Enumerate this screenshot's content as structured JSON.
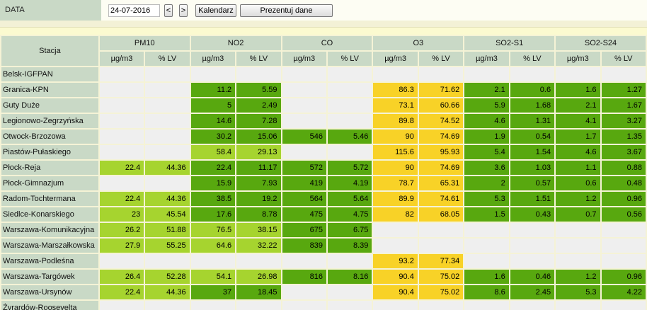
{
  "toolbar": {
    "label": "DATA",
    "date_value": "24-07-2016",
    "prev_label": "<",
    "next_label": ">",
    "calendar_label": "Kalendarz",
    "present_label": "Prezentuj dane"
  },
  "table": {
    "station_header": "Stacja",
    "groups": [
      "PM10",
      "NO2",
      "CO",
      "O3",
      "SO2-S1",
      "SO2-S24"
    ],
    "subheaders": [
      "µg/m3",
      "% LV"
    ],
    "level_colors": {
      "empty": "#efefef",
      "very_good": "#58a80f",
      "good": "#a6d42f",
      "moderate": "#f8d227"
    },
    "rows": [
      {
        "station": "Belsk-IGFPAN",
        "cells": [
          {
            "v": "",
            "l": "empty"
          },
          {
            "v": "",
            "l": "empty"
          },
          {
            "v": "",
            "l": "empty"
          },
          {
            "v": "",
            "l": "empty"
          },
          {
            "v": "",
            "l": "empty"
          },
          {
            "v": "",
            "l": "empty"
          },
          {
            "v": "",
            "l": "empty"
          },
          {
            "v": "",
            "l": "empty"
          },
          {
            "v": "",
            "l": "empty"
          },
          {
            "v": "",
            "l": "empty"
          },
          {
            "v": "",
            "l": "empty"
          },
          {
            "v": "",
            "l": "empty"
          }
        ]
      },
      {
        "station": "Granica-KPN",
        "cells": [
          {
            "v": "",
            "l": "empty"
          },
          {
            "v": "",
            "l": "empty"
          },
          {
            "v": "11.2",
            "l": "dark"
          },
          {
            "v": "5.59",
            "l": "dark"
          },
          {
            "v": "",
            "l": "empty"
          },
          {
            "v": "",
            "l": "empty"
          },
          {
            "v": "86.3",
            "l": "yellow"
          },
          {
            "v": "71.62",
            "l": "yellow"
          },
          {
            "v": "2.1",
            "l": "dark"
          },
          {
            "v": "0.6",
            "l": "dark"
          },
          {
            "v": "1.6",
            "l": "dark"
          },
          {
            "v": "1.27",
            "l": "dark"
          }
        ]
      },
      {
        "station": "Guty Duże",
        "cells": [
          {
            "v": "",
            "l": "empty"
          },
          {
            "v": "",
            "l": "empty"
          },
          {
            "v": "5",
            "l": "dark"
          },
          {
            "v": "2.49",
            "l": "dark"
          },
          {
            "v": "",
            "l": "empty"
          },
          {
            "v": "",
            "l": "empty"
          },
          {
            "v": "73.1",
            "l": "yellow"
          },
          {
            "v": "60.66",
            "l": "yellow"
          },
          {
            "v": "5.9",
            "l": "dark"
          },
          {
            "v": "1.68",
            "l": "dark"
          },
          {
            "v": "2.1",
            "l": "dark"
          },
          {
            "v": "1.67",
            "l": "dark"
          }
        ]
      },
      {
        "station": "Legionowo-Zegrzyńska",
        "cells": [
          {
            "v": "",
            "l": "empty"
          },
          {
            "v": "",
            "l": "empty"
          },
          {
            "v": "14.6",
            "l": "dark"
          },
          {
            "v": "7.28",
            "l": "dark"
          },
          {
            "v": "",
            "l": "empty"
          },
          {
            "v": "",
            "l": "empty"
          },
          {
            "v": "89.8",
            "l": "yellow"
          },
          {
            "v": "74.52",
            "l": "yellow"
          },
          {
            "v": "4.6",
            "l": "dark"
          },
          {
            "v": "1.31",
            "l": "dark"
          },
          {
            "v": "4.1",
            "l": "dark"
          },
          {
            "v": "3.27",
            "l": "dark"
          }
        ]
      },
      {
        "station": "Otwock-Brzozowa",
        "cells": [
          {
            "v": "",
            "l": "empty"
          },
          {
            "v": "",
            "l": "empty"
          },
          {
            "v": "30.2",
            "l": "dark"
          },
          {
            "v": "15.06",
            "l": "dark"
          },
          {
            "v": "546",
            "l": "dark"
          },
          {
            "v": "5.46",
            "l": "dark"
          },
          {
            "v": "90",
            "l": "yellow"
          },
          {
            "v": "74.69",
            "l": "yellow"
          },
          {
            "v": "1.9",
            "l": "dark"
          },
          {
            "v": "0.54",
            "l": "dark"
          },
          {
            "v": "1.7",
            "l": "dark"
          },
          {
            "v": "1.35",
            "l": "dark"
          }
        ]
      },
      {
        "station": "Piastów-Pułaskiego",
        "cells": [
          {
            "v": "",
            "l": "empty"
          },
          {
            "v": "",
            "l": "empty"
          },
          {
            "v": "58.4",
            "l": "light"
          },
          {
            "v": "29.13",
            "l": "light"
          },
          {
            "v": "",
            "l": "empty"
          },
          {
            "v": "",
            "l": "empty"
          },
          {
            "v": "115.6",
            "l": "yellow"
          },
          {
            "v": "95.93",
            "l": "yellow"
          },
          {
            "v": "5.4",
            "l": "dark"
          },
          {
            "v": "1.54",
            "l": "dark"
          },
          {
            "v": "4.6",
            "l": "dark"
          },
          {
            "v": "3.67",
            "l": "dark"
          }
        ]
      },
      {
        "station": "Płock-Reja",
        "cells": [
          {
            "v": "22.4",
            "l": "light"
          },
          {
            "v": "44.36",
            "l": "light"
          },
          {
            "v": "22.4",
            "l": "dark"
          },
          {
            "v": "11.17",
            "l": "dark"
          },
          {
            "v": "572",
            "l": "dark"
          },
          {
            "v": "5.72",
            "l": "dark"
          },
          {
            "v": "90",
            "l": "yellow"
          },
          {
            "v": "74.69",
            "l": "yellow"
          },
          {
            "v": "3.6",
            "l": "dark"
          },
          {
            "v": "1.03",
            "l": "dark"
          },
          {
            "v": "1.1",
            "l": "dark"
          },
          {
            "v": "0.88",
            "l": "dark"
          }
        ]
      },
      {
        "station": "Płock-Gimnazjum",
        "cells": [
          {
            "v": "",
            "l": "empty"
          },
          {
            "v": "",
            "l": "empty"
          },
          {
            "v": "15.9",
            "l": "dark"
          },
          {
            "v": "7.93",
            "l": "dark"
          },
          {
            "v": "419",
            "l": "dark"
          },
          {
            "v": "4.19",
            "l": "dark"
          },
          {
            "v": "78.7",
            "l": "yellow"
          },
          {
            "v": "65.31",
            "l": "yellow"
          },
          {
            "v": "2",
            "l": "dark"
          },
          {
            "v": "0.57",
            "l": "dark"
          },
          {
            "v": "0.6",
            "l": "dark"
          },
          {
            "v": "0.48",
            "l": "dark"
          }
        ]
      },
      {
        "station": "Radom-Tochtermana",
        "cells": [
          {
            "v": "22.4",
            "l": "light"
          },
          {
            "v": "44.36",
            "l": "light"
          },
          {
            "v": "38.5",
            "l": "dark"
          },
          {
            "v": "19.2",
            "l": "dark"
          },
          {
            "v": "564",
            "l": "dark"
          },
          {
            "v": "5.64",
            "l": "dark"
          },
          {
            "v": "89.9",
            "l": "yellow"
          },
          {
            "v": "74.61",
            "l": "yellow"
          },
          {
            "v": "5.3",
            "l": "dark"
          },
          {
            "v": "1.51",
            "l": "dark"
          },
          {
            "v": "1.2",
            "l": "dark"
          },
          {
            "v": "0.96",
            "l": "dark"
          }
        ]
      },
      {
        "station": "Siedlce-Konarskiego",
        "cells": [
          {
            "v": "23",
            "l": "light"
          },
          {
            "v": "45.54",
            "l": "light"
          },
          {
            "v": "17.6",
            "l": "dark"
          },
          {
            "v": "8.78",
            "l": "dark"
          },
          {
            "v": "475",
            "l": "dark"
          },
          {
            "v": "4.75",
            "l": "dark"
          },
          {
            "v": "82",
            "l": "yellow"
          },
          {
            "v": "68.05",
            "l": "yellow"
          },
          {
            "v": "1.5",
            "l": "dark"
          },
          {
            "v": "0.43",
            "l": "dark"
          },
          {
            "v": "0.7",
            "l": "dark"
          },
          {
            "v": "0.56",
            "l": "dark"
          }
        ]
      },
      {
        "station": "Warszawa-Komunikacyjna",
        "cells": [
          {
            "v": "26.2",
            "l": "light"
          },
          {
            "v": "51.88",
            "l": "light"
          },
          {
            "v": "76.5",
            "l": "light"
          },
          {
            "v": "38.15",
            "l": "light"
          },
          {
            "v": "675",
            "l": "dark"
          },
          {
            "v": "6.75",
            "l": "dark"
          },
          {
            "v": "",
            "l": "empty"
          },
          {
            "v": "",
            "l": "empty"
          },
          {
            "v": "",
            "l": "empty"
          },
          {
            "v": "",
            "l": "empty"
          },
          {
            "v": "",
            "l": "empty"
          },
          {
            "v": "",
            "l": "empty"
          }
        ]
      },
      {
        "station": "Warszawa-Marszałkowska",
        "cells": [
          {
            "v": "27.9",
            "l": "light"
          },
          {
            "v": "55.25",
            "l": "light"
          },
          {
            "v": "64.6",
            "l": "light"
          },
          {
            "v": "32.22",
            "l": "light"
          },
          {
            "v": "839",
            "l": "dark"
          },
          {
            "v": "8.39",
            "l": "dark"
          },
          {
            "v": "",
            "l": "empty"
          },
          {
            "v": "",
            "l": "empty"
          },
          {
            "v": "",
            "l": "empty"
          },
          {
            "v": "",
            "l": "empty"
          },
          {
            "v": "",
            "l": "empty"
          },
          {
            "v": "",
            "l": "empty"
          }
        ]
      },
      {
        "station": "Warszawa-Podleśna",
        "cells": [
          {
            "v": "",
            "l": "empty"
          },
          {
            "v": "",
            "l": "empty"
          },
          {
            "v": "",
            "l": "empty"
          },
          {
            "v": "",
            "l": "empty"
          },
          {
            "v": "",
            "l": "empty"
          },
          {
            "v": "",
            "l": "empty"
          },
          {
            "v": "93.2",
            "l": "yellow"
          },
          {
            "v": "77.34",
            "l": "yellow"
          },
          {
            "v": "",
            "l": "empty"
          },
          {
            "v": "",
            "l": "empty"
          },
          {
            "v": "",
            "l": "empty"
          },
          {
            "v": "",
            "l": "empty"
          }
        ]
      },
      {
        "station": "Warszawa-Targówek",
        "cells": [
          {
            "v": "26.4",
            "l": "light"
          },
          {
            "v": "52.28",
            "l": "light"
          },
          {
            "v": "54.1",
            "l": "light"
          },
          {
            "v": "26.98",
            "l": "light"
          },
          {
            "v": "816",
            "l": "dark"
          },
          {
            "v": "8.16",
            "l": "dark"
          },
          {
            "v": "90.4",
            "l": "yellow"
          },
          {
            "v": "75.02",
            "l": "yellow"
          },
          {
            "v": "1.6",
            "l": "dark"
          },
          {
            "v": "0.46",
            "l": "dark"
          },
          {
            "v": "1.2",
            "l": "dark"
          },
          {
            "v": "0.96",
            "l": "dark"
          }
        ]
      },
      {
        "station": "Warszawa-Ursynów",
        "cells": [
          {
            "v": "22.4",
            "l": "light"
          },
          {
            "v": "44.36",
            "l": "light"
          },
          {
            "v": "37",
            "l": "dark"
          },
          {
            "v": "18.45",
            "l": "dark"
          },
          {
            "v": "",
            "l": "empty"
          },
          {
            "v": "",
            "l": "empty"
          },
          {
            "v": "90.4",
            "l": "yellow"
          },
          {
            "v": "75.02",
            "l": "yellow"
          },
          {
            "v": "8.6",
            "l": "dark"
          },
          {
            "v": "2.45",
            "l": "dark"
          },
          {
            "v": "5.3",
            "l": "dark"
          },
          {
            "v": "4.22",
            "l": "dark"
          }
        ]
      },
      {
        "station": "Żyrardów-Roosevelta",
        "cells": [
          {
            "v": "",
            "l": "empty"
          },
          {
            "v": "",
            "l": "empty"
          },
          {
            "v": "",
            "l": "empty"
          },
          {
            "v": "",
            "l": "empty"
          },
          {
            "v": "",
            "l": "empty"
          },
          {
            "v": "",
            "l": "empty"
          },
          {
            "v": "",
            "l": "empty"
          },
          {
            "v": "",
            "l": "empty"
          },
          {
            "v": "",
            "l": "empty"
          },
          {
            "v": "",
            "l": "empty"
          },
          {
            "v": "",
            "l": "empty"
          },
          {
            "v": "",
            "l": "empty"
          }
        ]
      }
    ]
  }
}
